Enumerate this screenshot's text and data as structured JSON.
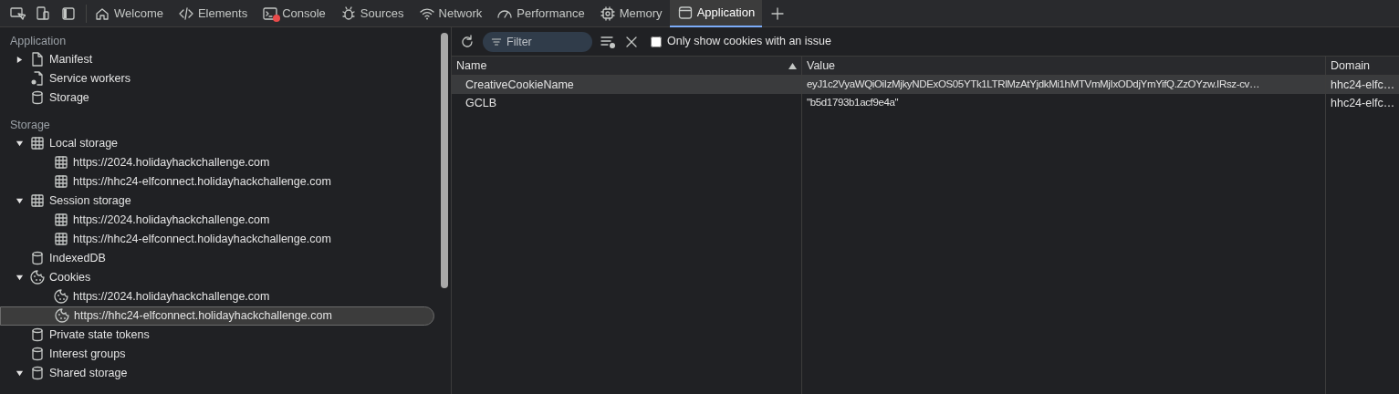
{
  "toolbar_icons": [
    {
      "kind": "inspect"
    },
    {
      "kind": "device"
    },
    {
      "kind": "panel"
    }
  ],
  "tabs": [
    {
      "label": "Welcome",
      "kind": "home",
      "selected": false,
      "error": false
    },
    {
      "label": "Elements",
      "kind": "code",
      "selected": false,
      "error": false
    },
    {
      "label": "Console",
      "kind": "console",
      "selected": false,
      "error": true
    },
    {
      "label": "Sources",
      "kind": "bug",
      "selected": false,
      "error": false
    },
    {
      "label": "Network",
      "kind": "wifi",
      "selected": false,
      "error": false
    },
    {
      "label": "Performance",
      "kind": "gauge",
      "selected": false,
      "error": false
    },
    {
      "label": "Memory",
      "kind": "chip",
      "selected": false,
      "error": false
    },
    {
      "label": "Application",
      "kind": "window",
      "selected": true,
      "error": false
    }
  ],
  "sidebar": {
    "sections": [
      {
        "title": "Application",
        "items": [
          {
            "label": "Manifest",
            "kind": "file",
            "expanded": false,
            "selected": false
          },
          {
            "label": "Service workers",
            "kind": "worker",
            "selected": false
          },
          {
            "label": "Storage",
            "kind": "db",
            "selected": false
          }
        ]
      },
      {
        "title": "Storage",
        "items": [
          {
            "label": "Local storage",
            "kind": "grid",
            "expanded": true,
            "selected": false,
            "children": [
              {
                "label": "https://2024.holidayhackchallenge.com",
                "kind": "grid",
                "selected": false
              },
              {
                "label": "https://hhc24-elfconnect.holidayhackchallenge.com",
                "kind": "grid",
                "selected": false
              }
            ]
          },
          {
            "label": "Session storage",
            "kind": "grid",
            "expanded": true,
            "selected": false,
            "children": [
              {
                "label": "https://2024.holidayhackchallenge.com",
                "kind": "grid",
                "selected": false
              },
              {
                "label": "https://hhc24-elfconnect.holidayhackchallenge.com",
                "kind": "grid",
                "selected": false
              }
            ]
          },
          {
            "label": "IndexedDB",
            "kind": "db",
            "selected": false
          },
          {
            "label": "Cookies",
            "kind": "cookie",
            "expanded": true,
            "selected": false,
            "children": [
              {
                "label": "https://2024.holidayhackchallenge.com",
                "kind": "cookie",
                "selected": false
              },
              {
                "label": "https://hhc24-elfconnect.holidayhackchallenge.com",
                "kind": "cookie",
                "selected": true
              }
            ]
          },
          {
            "label": "Private state tokens",
            "kind": "db",
            "selected": false
          },
          {
            "label": "Interest groups",
            "kind": "db",
            "selected": false
          },
          {
            "label": "Shared storage",
            "kind": "db",
            "expanded": true,
            "selected": false
          }
        ]
      }
    ]
  },
  "filter_bar": {
    "placeholder": "Filter",
    "only_issues_label": "Only show cookies with an issue",
    "only_issues_checked": false
  },
  "table": {
    "columns": [
      {
        "label": "Name",
        "sorted": true
      },
      {
        "label": "Value",
        "sorted": false
      },
      {
        "label": "Domain",
        "sorted": false
      }
    ],
    "rows": [
      {
        "cells": [
          "CreativeCookieName",
          "eyJ1c2VyaWQiOiIzMjkyNDExOS05YTk1LTRlMzAtYjdkMi1hMTVmMjIxODdjYmYifQ.ZzOYzw.IRsz-cv…",
          "hhc24-elfc…"
        ],
        "selected": true
      },
      {
        "cells": [
          "GCLB",
          "\"b5d1793b1acf9e4a\"",
          "hhc24-elfc…"
        ],
        "selected": false
      }
    ]
  }
}
